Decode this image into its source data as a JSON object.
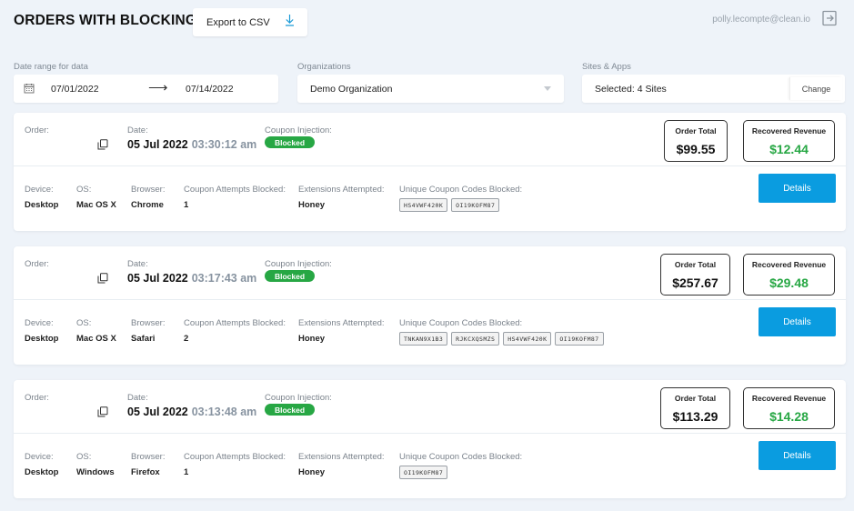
{
  "header": {
    "title": "ORDERS WITH BLOCKING",
    "export_label": "Export to CSV",
    "user_email": "polly.lecompte@clean.io"
  },
  "filters": {
    "date_range_label": "Date range for data",
    "date_from": "07/01/2022",
    "date_to": "07/14/2022",
    "date_arrow": "⟶",
    "organizations_label": "Organizations",
    "organization_value": "Demo Organization",
    "sites_label": "Sites & Apps",
    "sites_value": "Selected: 4 Sites",
    "change_label": "Change"
  },
  "labels": {
    "order": "Order:",
    "date": "Date:",
    "coupon_injection": "Coupon Injection:",
    "order_total": "Order Total",
    "recovered_revenue": "Recovered Revenue",
    "device": "Device:",
    "os": "OS:",
    "browser": "Browser:",
    "coupon_attempts": "Coupon Attempts Blocked:",
    "extensions": "Extensions Attempted:",
    "unique_codes": "Unique Coupon Codes Blocked:",
    "details": "Details"
  },
  "orders": [
    {
      "date": "05 Jul 2022",
      "time": "03:30:12 am",
      "injection_status": "Blocked",
      "order_total": "$99.55",
      "recovered_revenue": "$12.44",
      "device": "Desktop",
      "os": "Mac OS X",
      "browser": "Chrome",
      "coupon_attempts": "1",
      "extensions": "Honey",
      "codes": [
        "HS4VWF420K",
        "OI19KOFM87"
      ]
    },
    {
      "date": "05 Jul 2022",
      "time": "03:17:43 am",
      "injection_status": "Blocked",
      "order_total": "$257.67",
      "recovered_revenue": "$29.48",
      "device": "Desktop",
      "os": "Mac OS X",
      "browser": "Safari",
      "coupon_attempts": "2",
      "extensions": "Honey",
      "codes": [
        "TNKAN9X1B3",
        "RJKCXQSMZS",
        "HS4VWF420K",
        "OI19KOFM87"
      ]
    },
    {
      "date": "05 Jul 2022",
      "time": "03:13:48 am",
      "injection_status": "Blocked",
      "order_total": "$113.29",
      "recovered_revenue": "$14.28",
      "device": "Desktop",
      "os": "Windows",
      "browser": "Firefox",
      "coupon_attempts": "1",
      "extensions": "Honey",
      "codes": [
        "OI19KOFM87"
      ]
    }
  ],
  "colors": {
    "accent": "#0a9ce0",
    "success": "#27a744",
    "background": "#eef3f9"
  },
  "icons": {
    "export": "download-icon",
    "logout": "logout-icon",
    "calendar": "calendar-icon",
    "copy": "copy-icon",
    "dropdown": "chevron-down-icon"
  }
}
